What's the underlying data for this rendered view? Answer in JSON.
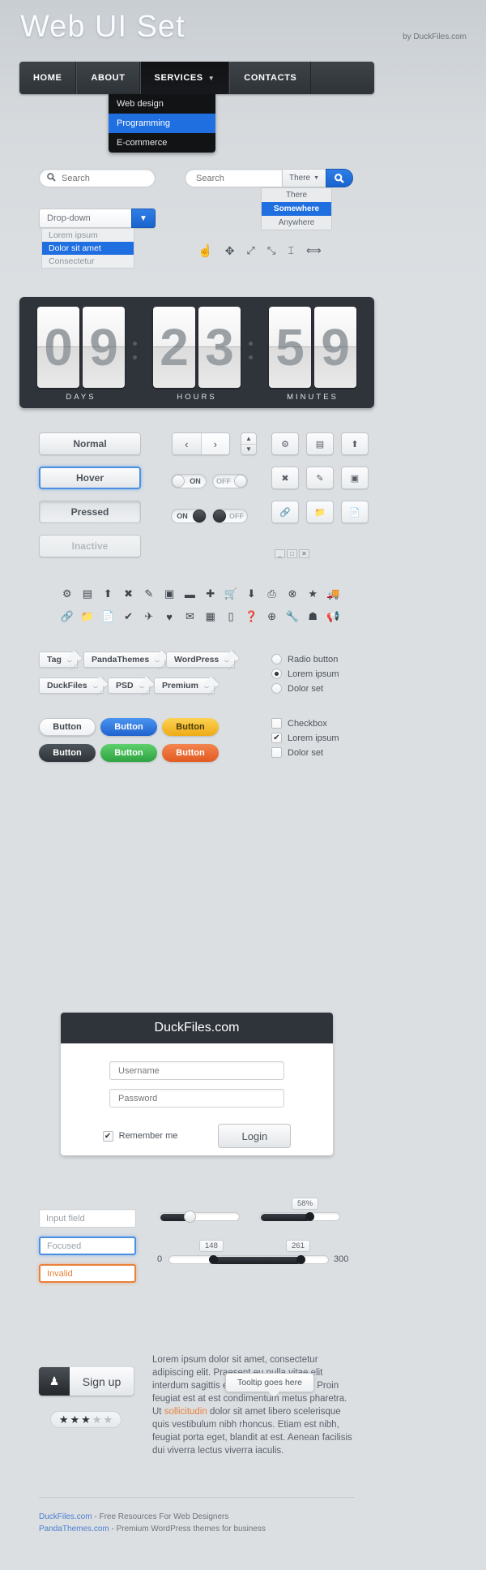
{
  "header": {
    "title": "Web UI Set",
    "byline": "by DuckFiles.com"
  },
  "nav": {
    "items": [
      {
        "label": "HOME",
        "active": false
      },
      {
        "label": "ABOUT",
        "active": false
      },
      {
        "label": "SERVICES",
        "active": true,
        "caret": "chevron-down"
      },
      {
        "label": "CONTACTS",
        "active": false
      }
    ],
    "submenu": [
      {
        "label": "Web design",
        "selected": false
      },
      {
        "label": "Programming",
        "selected": true
      },
      {
        "label": "E-commerce",
        "selected": false
      }
    ]
  },
  "search": {
    "simple": {
      "placeholder": "Search",
      "icon": "search-icon"
    },
    "grouped": {
      "placeholder": "Search",
      "scope_value": "There",
      "button_icon": "search-icon",
      "options": [
        {
          "label": "There",
          "selected": false
        },
        {
          "label": "Somewhere",
          "selected": true
        },
        {
          "label": "Anywhere",
          "selected": false
        }
      ]
    }
  },
  "dropdown": {
    "value": "Drop-down",
    "options": [
      {
        "label": "Lorem ipsum",
        "selected": false
      },
      {
        "label": "Dolor sit amet",
        "selected": true
      },
      {
        "label": "Consectetur",
        "selected": false
      }
    ]
  },
  "cursors": [
    "pointer-icon",
    "move-icon",
    "resize-diagonal-icon",
    "resize-corner-icon",
    "text-cursor-icon",
    "resize-horizontal-icon"
  ],
  "clock": {
    "groups": [
      {
        "label": "DAYS",
        "digits": [
          "0",
          "9"
        ]
      },
      {
        "label": "HOURS",
        "digits": [
          "2",
          "3"
        ]
      },
      {
        "label": "MINUTES",
        "digits": [
          "5",
          "9"
        ]
      }
    ]
  },
  "button_states": [
    {
      "label": "Normal",
      "state": "normal"
    },
    {
      "label": "Hover",
      "state": "hover"
    },
    {
      "label": "Pressed",
      "state": "pressed"
    },
    {
      "label": "Inactive",
      "state": "inactive"
    }
  ],
  "pager": {
    "prev": "‹",
    "next": "›"
  },
  "spinner": {
    "up": "▲",
    "down": "▼"
  },
  "toggles": [
    {
      "on_label": "ON",
      "off_label": "OFF",
      "state": "off"
    },
    {
      "on_label": "ON",
      "off_label": "OFF",
      "state": "on"
    }
  ],
  "icon_buttons": [
    [
      "gears-icon",
      "window-icon",
      "upload-icon"
    ],
    [
      "close-x-icon",
      "pencil-icon",
      "layers-icon"
    ],
    [
      "link-icon",
      "folder-icon",
      "file-icon"
    ]
  ],
  "window_controls": [
    "minimize-icon",
    "maximize-icon",
    "close-icon"
  ],
  "icon_grid": [
    "gears-icon",
    "window-icon",
    "upload-icon",
    "close-x-icon",
    "pencil-icon",
    "layers-icon",
    "minus-icon",
    "plus-icon",
    "cart-icon",
    "download-icon",
    "print-icon",
    "cancel-icon",
    "star-icon",
    "truck-icon",
    "link-icon",
    "folder-icon",
    "file-icon",
    "check-icon",
    "plane-icon",
    "heart-icon",
    "mail-icon",
    "chart-icon",
    "mobile-icon",
    "help-icon",
    "target-icon",
    "wrench-icon",
    "person-icon",
    "megaphone-icon"
  ],
  "tags": [
    [
      "Tag",
      "PandaThemes",
      "WordPress"
    ],
    [
      "DuckFiles",
      "PSD",
      "Premium"
    ]
  ],
  "radios": [
    {
      "label": "Radio button",
      "checked": false
    },
    {
      "label": "Lorem ipsum",
      "checked": true
    },
    {
      "label": "Dolor set",
      "checked": false
    }
  ],
  "checkboxes": [
    {
      "label": "Checkbox",
      "checked": false
    },
    {
      "label": "Lorem ipsum",
      "checked": true
    },
    {
      "label": "Dolor set",
      "checked": false
    }
  ],
  "pills": [
    {
      "label": "Button",
      "variant": "white",
      "bg": "#fbfbfc",
      "fg": "#3f464d"
    },
    {
      "label": "Button",
      "variant": "blue",
      "bg": "#2f7ee8",
      "fg": "#ffffff"
    },
    {
      "label": "Button",
      "variant": "yellow",
      "bg": "#f6bf2c",
      "fg": "#4a3c08"
    },
    {
      "label": "Button",
      "variant": "dark",
      "bg": "#3c4248",
      "fg": "#ffffff"
    },
    {
      "label": "Button",
      "variant": "green",
      "bg": "#3fb950",
      "fg": "#ffffff"
    },
    {
      "label": "Button",
      "variant": "orange",
      "bg": "#ec6b35",
      "fg": "#ffffff"
    }
  ],
  "login": {
    "title": "DuckFiles.com",
    "username_placeholder": "Username",
    "password_placeholder": "Password",
    "remember_label": "Remember me",
    "remember_checked": true,
    "submit_label": "Login"
  },
  "inputs": [
    {
      "value": "Input field",
      "state": "normal"
    },
    {
      "value": "Focused",
      "state": "focused"
    },
    {
      "value": "Invalid",
      "state": "invalid"
    }
  ],
  "sliders": {
    "plain_left": {
      "percent": 38
    },
    "plain_right": {
      "percent": 62,
      "bubble": "58%"
    },
    "range": {
      "min_label": "0",
      "max_label": "300",
      "low_bubble": "148",
      "high_bubble": "261",
      "low_percent": 33,
      "high_percent": 80
    }
  },
  "signup": {
    "label": "Sign up",
    "icon": "user-icon"
  },
  "rating": {
    "filled": 3,
    "total": 5
  },
  "tooltip": {
    "text": "Tooltip goes here"
  },
  "lorem": {
    "before": "Lorem ipsum dolor sit amet, consectetur adipiscing elit. Praesent eu nulla vitae elit interdum sagittis et eget mauris massa. Proin feugiat est at est condimentum metus pharetra. Ut ",
    "highlight": "sollicitudin",
    "after": " dolor sit amet libero scelerisque quis vestibulum nibh rhoncus. Etiam est nibh, feugiat porta eget, blandit at est. Aenean facilisis dui viverra lectus viverra iaculis."
  },
  "footer": {
    "lines": [
      {
        "link": "DuckFiles.com",
        "rest": " - Free Resources For Web Designers"
      },
      {
        "link": "PandaThemes.com",
        "rest": " - Premium WordPress themes for business"
      }
    ]
  },
  "colors": {
    "accent_blue": "#1f6fe0",
    "dark": "#2f343a",
    "invalid_orange": "#e8803a"
  }
}
